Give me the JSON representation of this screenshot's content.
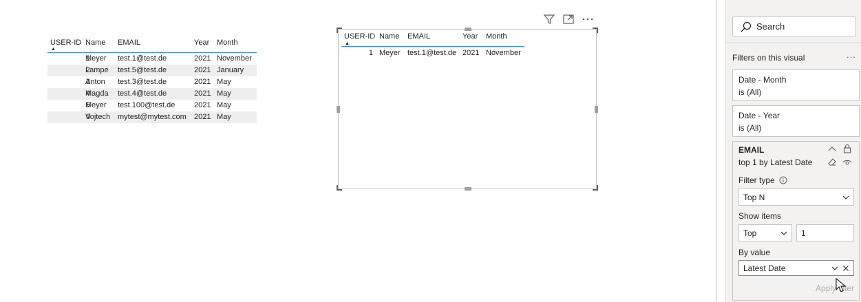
{
  "table_main": {
    "headers": [
      "USER-ID",
      "Name",
      "EMAIL",
      "Year",
      "Month"
    ],
    "rows": [
      [
        "1",
        "Meyer",
        "test.1@test.de",
        "2021",
        "November"
      ],
      [
        "2",
        "Lampe",
        "test.5@test.de",
        "2021",
        "January"
      ],
      [
        "3",
        "Anton",
        "test.3@test.de",
        "2021",
        "May"
      ],
      [
        "4",
        "Magda",
        "test.4@test.de",
        "2021",
        "May"
      ],
      [
        "5",
        "Meyer",
        "test.100@test.de",
        "2021",
        "May"
      ],
      [
        "6",
        "Vojtech",
        "mytest@mytest.com",
        "2021",
        "May"
      ]
    ]
  },
  "table_filtered": {
    "headers": [
      "USER-ID",
      "Name",
      "EMAIL",
      "Year",
      "Month"
    ],
    "rows": [
      [
        "1",
        "Meyer",
        "test.1@test.de",
        "2021",
        "November"
      ]
    ]
  },
  "visual_header_icons": [
    "filter-icon",
    "focus-mode-icon",
    "more-options-icon"
  ],
  "filters_pane": {
    "search_placeholder": "Search",
    "section_title": "Filters on this visual",
    "section_more": "...",
    "cards": [
      {
        "title": "Date - Month",
        "summary": "is (All)"
      },
      {
        "title": "Date - Year",
        "summary": "is (All)"
      }
    ],
    "expanded": {
      "title": "EMAIL",
      "summary": "top 1 by Latest Date",
      "filter_type_label": "Filter type",
      "filter_type_value": "Top N",
      "show_items_label": "Show items",
      "show_items_direction": "Top",
      "show_items_count": "1",
      "by_value_label": "By value",
      "by_value_field": "Latest Date",
      "apply_label": "Apply filter"
    }
  },
  "colors": {
    "header_rule": "#3a8fd6",
    "alt_row": "#eeeeee",
    "pane_bg": "#f3f2f1"
  }
}
